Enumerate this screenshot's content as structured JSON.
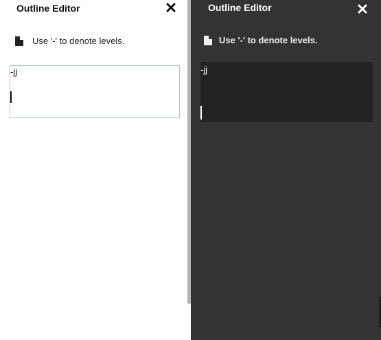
{
  "light_panel": {
    "title": "Outline Editor",
    "close_icon": "close-x-icon",
    "hint_icon": "document-icon",
    "hint_text": "Use '-' to denote levels.",
    "editor_text": "-jj"
  },
  "dark_panel": {
    "title": "Outline Editor",
    "close_icon": "close-x-icon",
    "hint_icon": "document-icon",
    "hint_text": "Use '-' to denote levels.",
    "editor_text": "-jj"
  },
  "colors": {
    "light_background": "#ffffff",
    "dark_background": "#333333",
    "dark_editor_background": "#222222",
    "light_editor_border": "#a9c3df",
    "divider": "#b3b3b3"
  }
}
